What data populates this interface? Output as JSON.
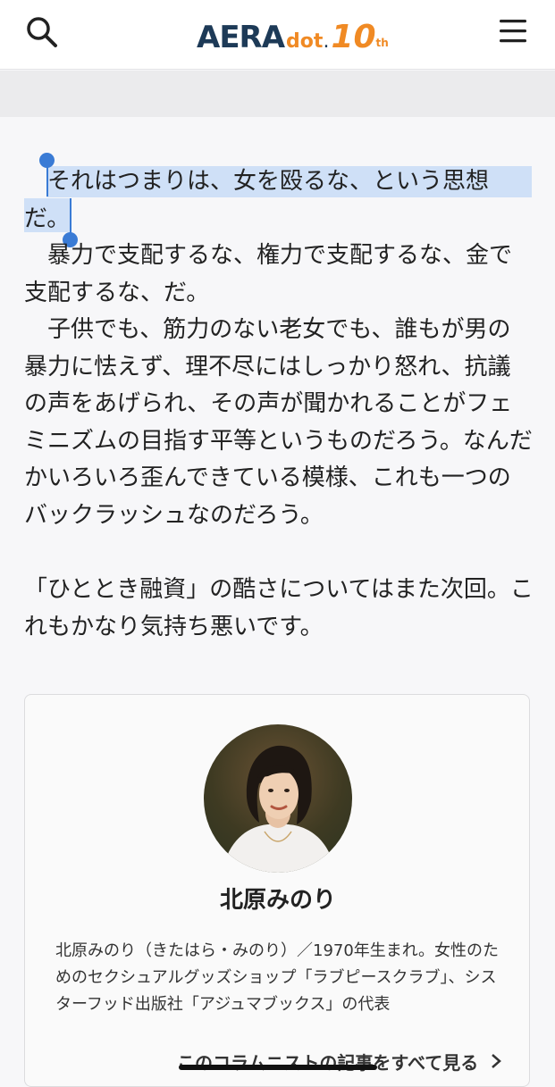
{
  "header": {
    "logo_main": "AERA",
    "logo_sub": "dot",
    "logo_dot": ".",
    "logo_ten": "10",
    "logo_th": "th",
    "search_icon": "search-icon",
    "menu_icon": "hamburger-menu-icon"
  },
  "article": {
    "selected_text": "それはつまりは、女を殴るな、という思想だ。",
    "p1": "暴力で支配するな、権力で支配するな、金で支配するな、だ。",
    "p2": "子供でも、筋力のない老女でも、誰もが男の暴力に怯えず、理不尽にはしっかり怒れ、抗議の声をあげられ、その声が聞かれることがフェミニズムの目指す平等というものだろう。なんだかいろいろ歪んできている模様、これも一つのバックラッシュなのだろう。",
    "p3": "「ひととき融資」の酷さについてはまた次回。これもかなり気持ち悪いです。"
  },
  "author": {
    "name": "北原みのり",
    "bio": "北原みのり（きたはら・みのり）／1970年生まれ。女性のためのセクシュアルグッズショップ「ラブピースクラブ」、シスターフッド出版社「アジュマブックス」の代表",
    "more_link": "このコラムニストの記事をすべて見る",
    "more_icon": "chevron-right-icon"
  },
  "colors": {
    "selection": "#cfe0f7",
    "caret": "#3a7bd5",
    "logo_navy": "#1d3a57",
    "logo_orange": "#f08a24"
  }
}
